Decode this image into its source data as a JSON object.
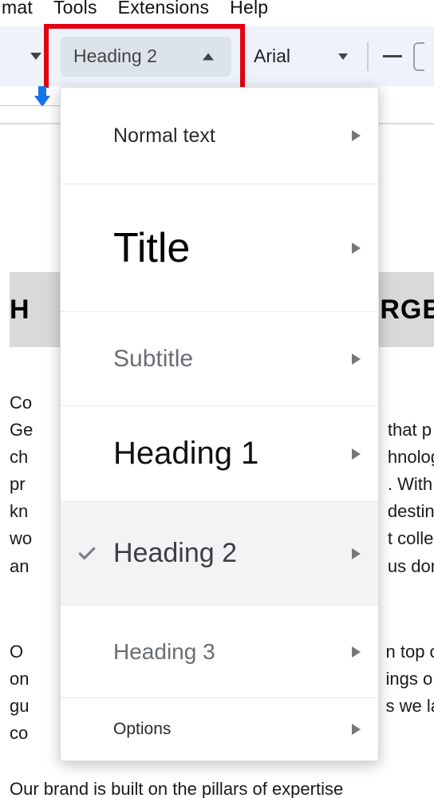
{
  "menubar": {
    "items": [
      "mat",
      "Tools",
      "Extensions",
      "Help"
    ]
  },
  "toolbar": {
    "style_label": "Heading 2",
    "font_family": "Arial"
  },
  "styles_dropdown": {
    "items": [
      {
        "label": "Normal text"
      },
      {
        "label": "Title"
      },
      {
        "label": "Subtitle"
      },
      {
        "label": "Heading 1"
      },
      {
        "label": "Heading 2",
        "selected": true
      },
      {
        "label": "Heading 3"
      },
      {
        "label": "Options"
      }
    ]
  },
  "document": {
    "heading_left_fragment": "H",
    "heading_right_fragment": "RGE",
    "paragraph1_fragments": [
      "Co",
      "Ge",
      "ch",
      "pr",
      "kn",
      "wo",
      "an",
      "that p",
      "hnolog",
      ". With",
      "destin",
      "t colle",
      "us don"
    ],
    "paragraph2_fragments": [
      "O",
      "on",
      "gu",
      "co",
      "n top o",
      "ings o",
      "s we la"
    ],
    "paragraph3": "Our brand is built on the pillars of expertise"
  }
}
